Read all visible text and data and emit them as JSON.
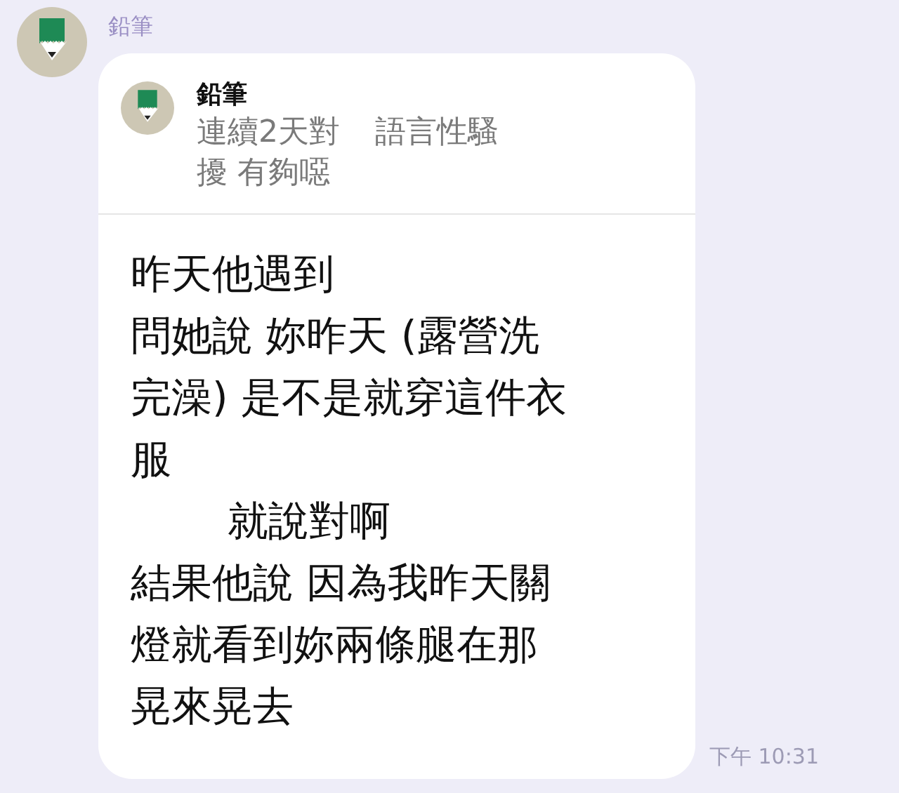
{
  "sender": {
    "name": "鉛筆"
  },
  "message": {
    "reply": {
      "name": "鉛筆",
      "lines": [
        {
          "segments": [
            "連續2天對",
            "語言性騷"
          ]
        },
        {
          "segments": [
            "擾 有夠噁"
          ]
        }
      ]
    },
    "lines": [
      {
        "segments": [
          "昨天他遇到"
        ],
        "indent": false
      },
      {
        "segments": [
          "問她說 妳昨天 (露營洗"
        ],
        "indent": false
      },
      {
        "segments": [
          "完澡) 是不是就穿這件衣"
        ],
        "indent": false
      },
      {
        "segments": [
          "服"
        ],
        "indent": false
      },
      {
        "segments": [
          "就說對啊"
        ],
        "indent": true
      },
      {
        "segments": [
          "結果他說 因為我昨天關"
        ],
        "indent": false
      },
      {
        "segments": [
          "燈就看到妳兩條腿在那"
        ],
        "indent": false
      },
      {
        "segments": [
          "晃來晃去"
        ],
        "indent": false
      }
    ],
    "time": "下午 10:31"
  }
}
